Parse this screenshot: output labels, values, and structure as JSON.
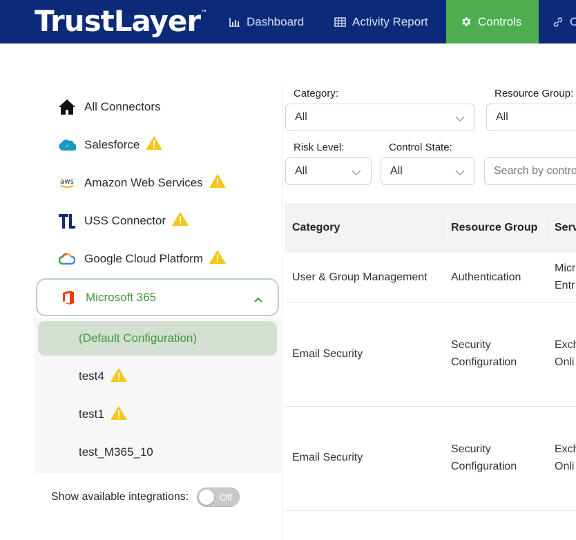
{
  "header": {
    "logo": "TrustLayer",
    "logo_mark": "™",
    "nav": [
      {
        "label": "Dashboard",
        "icon": "bar-chart-icon"
      },
      {
        "label": "Activity Report",
        "icon": "table-grid-icon"
      },
      {
        "label": "Controls",
        "icon": "gear-icon",
        "active": true
      },
      {
        "label": "C",
        "icon": "link-icon"
      }
    ],
    "active_color": "#4cae4f",
    "background": "#0d2a7a"
  },
  "sidebar": {
    "connectors": [
      {
        "label": "All Connectors",
        "icon": "home-icon",
        "warning": false
      },
      {
        "label": "Salesforce",
        "icon": "salesforce-cloud-icon",
        "warning": true
      },
      {
        "label": "Amazon Web Services",
        "icon": "aws-logo-icon",
        "warning": true
      },
      {
        "label": "USS Connector",
        "icon": "tl-logo-icon",
        "warning": true
      },
      {
        "label": "Google Cloud Platform",
        "icon": "google-cloud-icon",
        "warning": true
      },
      {
        "label": "Microsoft 365",
        "icon": "office-logo-icon",
        "warning": false,
        "expanded": true
      }
    ],
    "configurations": [
      {
        "label": "(Default Configuration)",
        "active": true,
        "warning": false
      },
      {
        "label": "test4",
        "warning": true
      },
      {
        "label": "test1",
        "warning": true
      },
      {
        "label": "test_M365_10",
        "warning": false
      }
    ],
    "toggle_label": "Show available integrations:",
    "toggle_state": "Off"
  },
  "filters": {
    "category_label": "Category:",
    "category_value": "All",
    "resource_group_label": "Resource Group:",
    "resource_group_value": "All",
    "risk_level_label": "Risk Level:",
    "risk_level_value": "All",
    "control_state_label": "Control State:",
    "control_state_value": "All",
    "search_placeholder": "Search by contro"
  },
  "table": {
    "columns": [
      "Category",
      "Resource Group",
      "Serv"
    ],
    "rows": [
      {
        "category": "User & Group Management",
        "resource_group": "Authentication",
        "service": "Micr\nEntr"
      },
      {
        "category": "Email Security",
        "resource_group": "Security\nConfiguration",
        "service": "Exch\nOnli"
      },
      {
        "category": "Email Security",
        "resource_group": "Security\nConfiguration",
        "service": "Exch\nOnli"
      }
    ]
  }
}
